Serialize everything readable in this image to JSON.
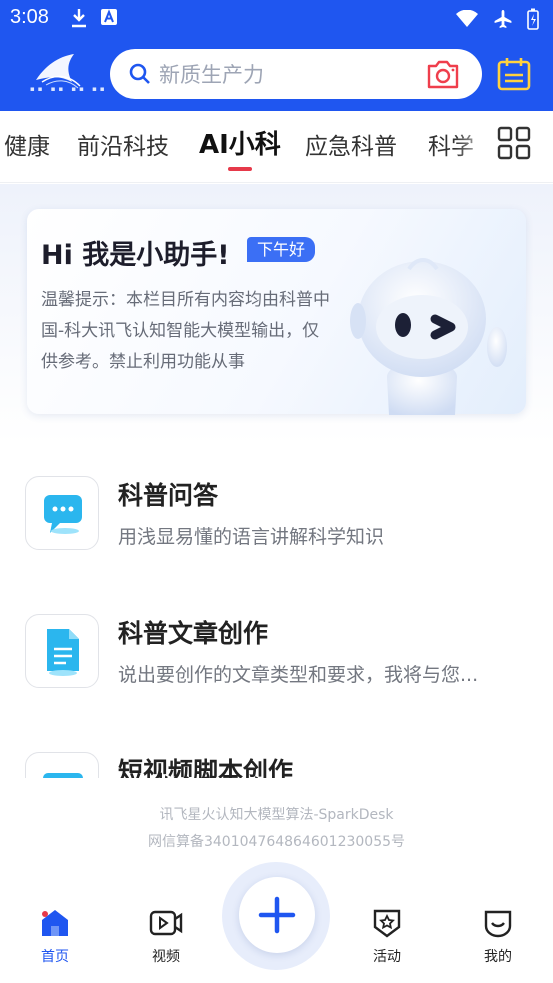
{
  "status_bar": {
    "time": "3:08"
  },
  "search": {
    "placeholder": "新质生产力"
  },
  "tabs": [
    {
      "label": "健康"
    },
    {
      "label": "前沿科技"
    },
    {
      "label": "AI小科"
    },
    {
      "label": "应急科普"
    },
    {
      "label": "科学"
    }
  ],
  "assistant_card": {
    "title": "Hi 我是小助手!",
    "badge": "下午好",
    "notice": "温馨提示：本栏目所有内容均由科普中国-科大讯飞认知智能大模型输出，仅供参考。禁止利用功能从事"
  },
  "features": [
    {
      "title": "科普问答",
      "desc": "用浅显易懂的语言讲解科学知识"
    },
    {
      "title": "科普文章创作",
      "desc": "说出要创作的文章类型和要求，我将与您..."
    },
    {
      "title": "短视频脚本创作",
      "desc": ""
    }
  ],
  "footer": {
    "line1": "讯飞星火认知大模型算法-SparkDesk",
    "line2": "网信算备340104764864601230055号"
  },
  "bottom_nav": [
    {
      "label": "首页",
      "icon": "home-icon",
      "active": true
    },
    {
      "label": "视频",
      "icon": "video-icon",
      "active": false
    },
    {
      "label": "活动",
      "icon": "star-badge-icon",
      "active": false
    },
    {
      "label": "我的",
      "icon": "profile-icon",
      "active": false
    }
  ],
  "colors": {
    "brand_blue": "#1f56f0",
    "accent_red": "#e6394a",
    "badge_blue": "#3b6ff5"
  }
}
